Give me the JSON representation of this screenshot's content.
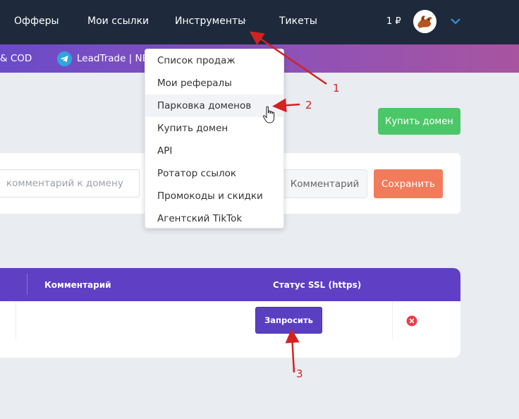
{
  "nav": {
    "items": [
      {
        "label": "Офферы"
      },
      {
        "label": "Мои ссылки"
      },
      {
        "label": "Инструменты"
      },
      {
        "label": "Тикеты"
      }
    ],
    "balance": "1 ₽"
  },
  "banner": {
    "left_text": "& COD",
    "text": "LeadTrade | NE"
  },
  "dropdown": {
    "items": [
      {
        "label": "Список продаж"
      },
      {
        "label": "Мои рефералы"
      },
      {
        "label": "Парковка доменов"
      },
      {
        "label": "Купить домен"
      },
      {
        "label": "API"
      },
      {
        "label": "Ротатор ссылок"
      },
      {
        "label": "Промокоды и скидки"
      },
      {
        "label": "Агентский TikTok"
      }
    ],
    "hovered": "Парковка доменов"
  },
  "buy_domain_button": "Купить домен",
  "form": {
    "comment_placeholder": "комментарий к домену",
    "comment_button": "Комментарий",
    "save_button": "Сохранить"
  },
  "table": {
    "headers": [
      "Комментарий",
      "Статус SSL (https)"
    ],
    "request_button": "Запросить"
  },
  "annotations": [
    "1",
    "2",
    "3"
  ],
  "colors": {
    "topbar": "#1e2a3b",
    "banner_start": "#6b4bc8",
    "banner_end": "#a8549f",
    "buy_button": "#4cc768",
    "save_button": "#f27b5b",
    "table_header": "#5f3fc4",
    "annotation": "#d42222",
    "accent_chevron": "#3b8fe0"
  },
  "icons": [
    "chevron-down-icon",
    "avatar-dragon-icon",
    "telegram-icon",
    "delete-circle-icon",
    "hand-cursor-icon"
  ]
}
